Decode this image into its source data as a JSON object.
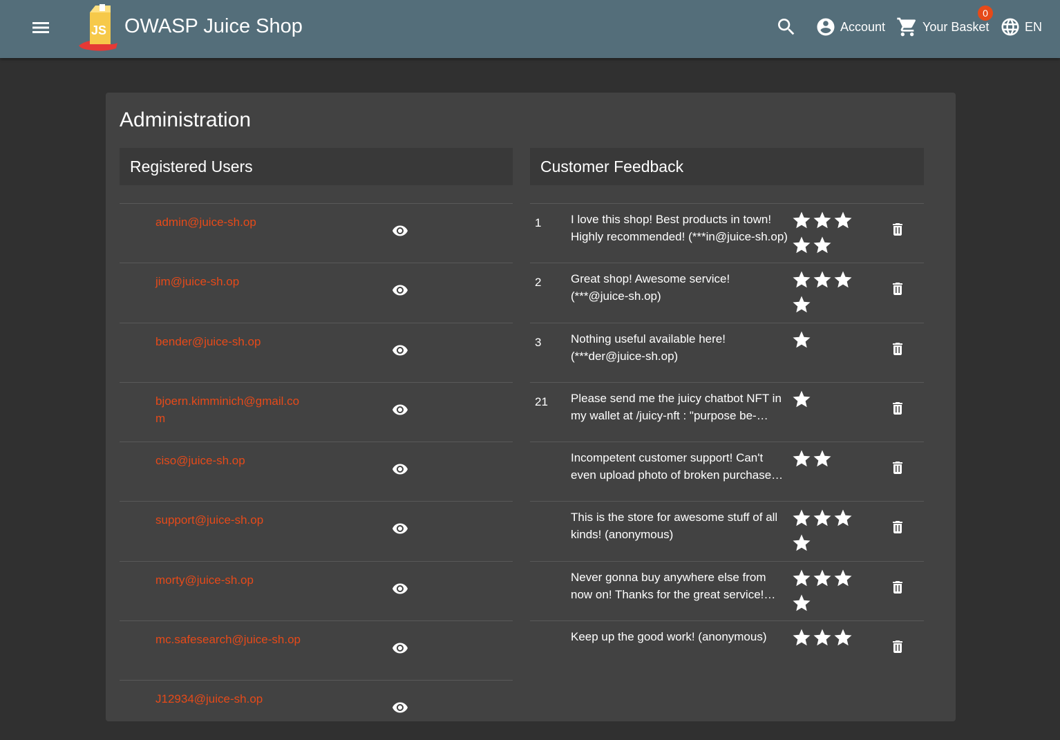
{
  "header": {
    "app_title": "OWASP Juice Shop",
    "account_label": "Account",
    "basket_label": "Your Basket",
    "basket_count": "0",
    "language_label": "EN",
    "colors": {
      "toolbar": "#546e7a",
      "accent": "#e64a19"
    },
    "icons": [
      "menu-icon",
      "juice-shop-logo",
      "search-icon",
      "account-circle-icon",
      "shopping-cart-icon",
      "language-icon"
    ]
  },
  "page": {
    "title": "Administration"
  },
  "users": {
    "title": "Registered Users",
    "items": [
      {
        "email": "admin@juice-sh.op"
      },
      {
        "email": "jim@juice-sh.op"
      },
      {
        "email": "bender@juice-sh.op"
      },
      {
        "email": "bjoern.kimminich@gmail.com"
      },
      {
        "email": "ciso@juice-sh.op"
      },
      {
        "email": "support@juice-sh.op"
      },
      {
        "email": "morty@juice-sh.op"
      },
      {
        "email": "mc.safesearch@juice-sh.op"
      },
      {
        "email": "J12934@juice-sh.op"
      }
    ]
  },
  "feedback": {
    "title": "Customer Feedback",
    "items": [
      {
        "id": "1",
        "comment": "I love this shop! Best products in town! Highly recommended! (***in@juice-sh.op)",
        "rating": 5
      },
      {
        "id": "2",
        "comment": "Great shop! Awesome service! (***@juice-sh.op)",
        "rating": 4
      },
      {
        "id": "3",
        "comment": "Nothing useful available here! (***der@juice-sh.op)",
        "rating": 1
      },
      {
        "id": "21",
        "comment": "Please send me the juicy chatbot NFT in my wallet at /juicy-nft : \"purpose be-…",
        "rating": 1
      },
      {
        "id": "",
        "comment": "Incompetent customer support! Can't even upload photo of broken purchase…",
        "rating": 2
      },
      {
        "id": "",
        "comment": "This is the store for awesome stuff of all kinds! (anonymous)",
        "rating": 4
      },
      {
        "id": "",
        "comment": "Never gonna buy anywhere else from now on! Thanks for the great service!…",
        "rating": 4
      },
      {
        "id": "",
        "comment": "Keep up the good work! (anonymous)",
        "rating": 3
      }
    ]
  }
}
